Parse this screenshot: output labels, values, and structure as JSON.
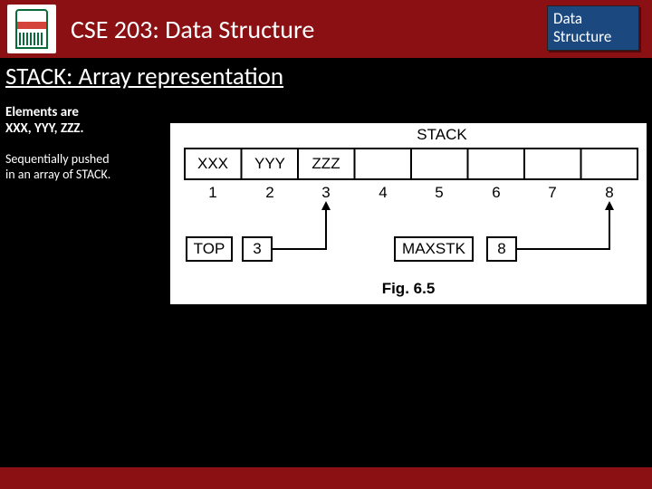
{
  "header": {
    "course_title": "CSE 203: Data Structure",
    "badge_line1": "Data",
    "badge_line2": "Structure"
  },
  "section_title": "STACK: Array representation",
  "elements": {
    "line1": "Elements are",
    "line2": "XXX, YYY, ZZZ."
  },
  "pushed": {
    "line1": "Sequentially pushed",
    "line2": "in an array of STACK."
  },
  "diagram": {
    "title": "STACK",
    "cells": [
      "XXX",
      "YYY",
      "ZZZ",
      "",
      "",
      "",
      "",
      ""
    ],
    "indices": [
      "1",
      "2",
      "3",
      "4",
      "5",
      "6",
      "7",
      "8"
    ],
    "top_label": "TOP",
    "top_value": "3",
    "maxstk_label": "MAXSTK",
    "maxstk_value": "8",
    "caption": "Fig. 6.5"
  }
}
